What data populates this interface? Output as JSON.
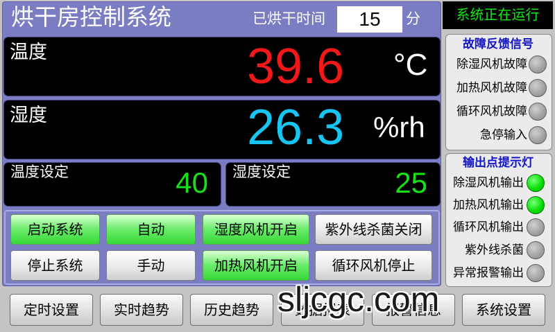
{
  "title": "烘干房控制系统",
  "dry_time": {
    "label": "已烘干时间",
    "value": "15",
    "unit": "分"
  },
  "status": "系统正在运行",
  "temperature": {
    "label": "温度",
    "value": "39.6",
    "unit": "°C"
  },
  "humidity": {
    "label": "湿度",
    "value": "26.3",
    "unit": "%rh"
  },
  "setpoints": {
    "temp_label": "温度设定",
    "temp_value": "40",
    "hum_label": "湿度设定",
    "hum_value": "25"
  },
  "controls": [
    {
      "label": "启动系统",
      "active": true
    },
    {
      "label": "自动",
      "active": true
    },
    {
      "label": "湿度风机开启",
      "active": true
    },
    {
      "label": "紫外线杀菌关闭",
      "active": false
    },
    {
      "label": "停止系统",
      "active": false
    },
    {
      "label": "手动",
      "active": false
    },
    {
      "label": "加热风机开启",
      "active": true
    },
    {
      "label": "循环风机停止",
      "active": false
    }
  ],
  "fault_panel": {
    "title": "故障反馈信号",
    "items": [
      {
        "label": "除湿风机故障",
        "lit": false
      },
      {
        "label": "加热风机故障",
        "lit": false
      },
      {
        "label": "循环风机故障",
        "lit": false
      },
      {
        "label": "急停输入",
        "lit": false
      }
    ]
  },
  "output_panel": {
    "title": "输出点提示灯",
    "items": [
      {
        "label": "除湿风机输出",
        "lit": true
      },
      {
        "label": "加热风机输出",
        "lit": true
      },
      {
        "label": "循环风机输出",
        "lit": false
      },
      {
        "label": "紫外线杀菌",
        "lit": false
      },
      {
        "label": "异常报警输出",
        "lit": false
      }
    ]
  },
  "nav": [
    "定时设置",
    "实时趋势",
    "历史趋势",
    "数据报表",
    "报警信息",
    "系统设置"
  ],
  "watermark": "sljcgc.com",
  "colors": {
    "frame": "#7b7dc2",
    "temp_value": "#f01818",
    "hum_value": "#18c4f0",
    "set_value": "#18e018",
    "status_text": "#12e812",
    "lamp_on": "#00dd00",
    "lamp_off": "#a0a0a0",
    "panel_title": "#1414c8"
  }
}
